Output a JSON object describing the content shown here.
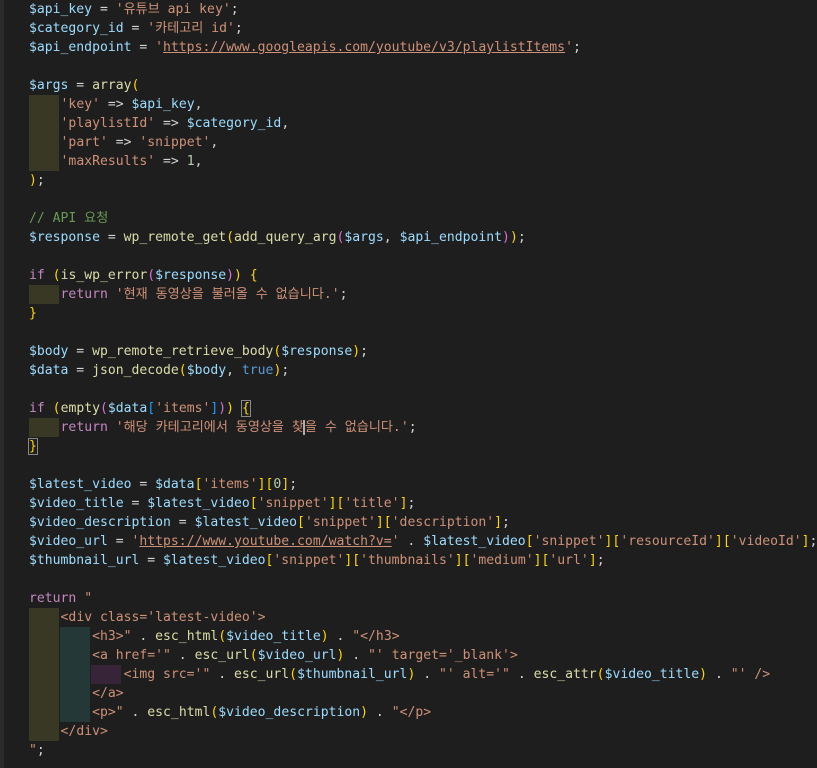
{
  "editor": {
    "language": "php",
    "theme": "dark",
    "colors": {
      "background": "#1e1e1e",
      "variable": "#9cdcfe",
      "string": "#ce9178",
      "function": "#dcdcaa",
      "keyword": "#c586c0",
      "constant": "#569cd6",
      "comment": "#6a9955",
      "number": "#b5cea8",
      "bracket_level1": "#ffd700",
      "bracket_level2": "#da70d6",
      "bracket_level3": "#179fff"
    },
    "lines": [
      {
        "indent": 0,
        "tokens": [
          [
            "var",
            "$api_key"
          ],
          [
            "op",
            " = "
          ],
          [
            "str",
            "'유튜브 api key'"
          ],
          [
            "op",
            ";"
          ]
        ]
      },
      {
        "indent": 0,
        "tokens": [
          [
            "var",
            "$category_id"
          ],
          [
            "op",
            " = "
          ],
          [
            "str",
            "'카테고리 id'"
          ],
          [
            "op",
            ";"
          ]
        ]
      },
      {
        "indent": 0,
        "tokens": [
          [
            "var",
            "$api_endpoint"
          ],
          [
            "op",
            " = "
          ],
          [
            "str",
            "'"
          ],
          [
            "str-link",
            "https://www.googleapis.com/youtube/v3/playlistItems"
          ],
          [
            "str",
            "'"
          ],
          [
            "op",
            ";"
          ]
        ]
      },
      {
        "indent": 0,
        "tokens": []
      },
      {
        "indent": 0,
        "tokens": [
          [
            "var",
            "$args"
          ],
          [
            "op",
            " = "
          ],
          [
            "fn",
            "array"
          ],
          [
            "br1",
            "("
          ]
        ]
      },
      {
        "indent": 1,
        "tokens": [
          [
            "str",
            "'key'"
          ],
          [
            "op",
            " => "
          ],
          [
            "var",
            "$api_key"
          ],
          [
            "op",
            ","
          ]
        ]
      },
      {
        "indent": 1,
        "tokens": [
          [
            "str",
            "'playlistId'"
          ],
          [
            "op",
            " => "
          ],
          [
            "var",
            "$category_id"
          ],
          [
            "op",
            ","
          ]
        ]
      },
      {
        "indent": 1,
        "tokens": [
          [
            "str",
            "'part'"
          ],
          [
            "op",
            " => "
          ],
          [
            "str",
            "'snippet'"
          ],
          [
            "op",
            ","
          ]
        ]
      },
      {
        "indent": 1,
        "tokens": [
          [
            "str",
            "'maxResults'"
          ],
          [
            "op",
            " => "
          ],
          [
            "num",
            "1"
          ],
          [
            "op",
            ","
          ]
        ]
      },
      {
        "indent": 0,
        "tokens": [
          [
            "br1",
            ")"
          ],
          [
            "op",
            ";"
          ]
        ]
      },
      {
        "indent": 0,
        "tokens": []
      },
      {
        "indent": 0,
        "tokens": [
          [
            "cmt",
            "// API 요청"
          ]
        ]
      },
      {
        "indent": 0,
        "tokens": [
          [
            "var",
            "$response"
          ],
          [
            "op",
            " = "
          ],
          [
            "fn",
            "wp_remote_get"
          ],
          [
            "br1",
            "("
          ],
          [
            "fn",
            "add_query_arg"
          ],
          [
            "br2",
            "("
          ],
          [
            "var",
            "$args"
          ],
          [
            "op",
            ", "
          ],
          [
            "var",
            "$api_endpoint"
          ],
          [
            "br2",
            ")"
          ],
          [
            "br1",
            ")"
          ],
          [
            "op",
            ";"
          ]
        ]
      },
      {
        "indent": 0,
        "tokens": []
      },
      {
        "indent": 0,
        "tokens": [
          [
            "kw",
            "if"
          ],
          [
            "op",
            " "
          ],
          [
            "br1",
            "("
          ],
          [
            "fn",
            "is_wp_error"
          ],
          [
            "br2",
            "("
          ],
          [
            "var",
            "$response"
          ],
          [
            "br2",
            ")"
          ],
          [
            "br1",
            ")"
          ],
          [
            "op",
            " "
          ],
          [
            "br1",
            "{"
          ]
        ]
      },
      {
        "indent": 1,
        "tokens": [
          [
            "kw",
            "return"
          ],
          [
            "op",
            " "
          ],
          [
            "str",
            "'현재 동영상을 불러올 수 없습니다.'"
          ],
          [
            "op",
            ";"
          ]
        ]
      },
      {
        "indent": 0,
        "tokens": [
          [
            "br1",
            "}"
          ]
        ]
      },
      {
        "indent": 0,
        "tokens": []
      },
      {
        "indent": 0,
        "tokens": [
          [
            "var",
            "$body"
          ],
          [
            "op",
            " = "
          ],
          [
            "fn",
            "wp_remote_retrieve_body"
          ],
          [
            "br1",
            "("
          ],
          [
            "var",
            "$response"
          ],
          [
            "br1",
            ")"
          ],
          [
            "op",
            ";"
          ]
        ]
      },
      {
        "indent": 0,
        "tokens": [
          [
            "var",
            "$data"
          ],
          [
            "op",
            " = "
          ],
          [
            "fn",
            "json_decode"
          ],
          [
            "br1",
            "("
          ],
          [
            "var",
            "$body"
          ],
          [
            "op",
            ", "
          ],
          [
            "const",
            "true"
          ],
          [
            "br1",
            ")"
          ],
          [
            "op",
            ";"
          ]
        ]
      },
      {
        "indent": 0,
        "tokens": []
      },
      {
        "indent": 0,
        "tokens": [
          [
            "kw",
            "if"
          ],
          [
            "op",
            " "
          ],
          [
            "br1",
            "("
          ],
          [
            "fn",
            "empty"
          ],
          [
            "br2",
            "("
          ],
          [
            "var",
            "$data"
          ],
          [
            "br3",
            "["
          ],
          [
            "str",
            "'items'"
          ],
          [
            "br3",
            "]"
          ],
          [
            "br2",
            ")"
          ],
          [
            "br1",
            ")"
          ],
          [
            "op",
            " "
          ],
          [
            "br1-match",
            "{"
          ]
        ]
      },
      {
        "indent": 1,
        "tokens": [
          [
            "kw",
            "return"
          ],
          [
            "op",
            " "
          ],
          [
            "str",
            "'해당 카테고리에서 동영상을 찾"
          ],
          [
            "cursor",
            ""
          ],
          [
            "str",
            "을 수 없습니다.'"
          ],
          [
            "op",
            ";"
          ]
        ]
      },
      {
        "indent": 0,
        "tokens": [
          [
            "br1-match",
            "}"
          ]
        ]
      },
      {
        "indent": 0,
        "tokens": []
      },
      {
        "indent": 0,
        "tokens": [
          [
            "var",
            "$latest_video"
          ],
          [
            "op",
            " = "
          ],
          [
            "var",
            "$data"
          ],
          [
            "br1",
            "["
          ],
          [
            "str",
            "'items'"
          ],
          [
            "br1",
            "]"
          ],
          [
            "br1",
            "["
          ],
          [
            "num",
            "0"
          ],
          [
            "br1",
            "]"
          ],
          [
            "op",
            ";"
          ]
        ]
      },
      {
        "indent": 0,
        "tokens": [
          [
            "var",
            "$video_title"
          ],
          [
            "op",
            " = "
          ],
          [
            "var",
            "$latest_video"
          ],
          [
            "br1",
            "["
          ],
          [
            "str",
            "'snippet'"
          ],
          [
            "br1",
            "]"
          ],
          [
            "br1",
            "["
          ],
          [
            "str",
            "'title'"
          ],
          [
            "br1",
            "]"
          ],
          [
            "op",
            ";"
          ]
        ]
      },
      {
        "indent": 0,
        "tokens": [
          [
            "var",
            "$video_description"
          ],
          [
            "op",
            " = "
          ],
          [
            "var",
            "$latest_video"
          ],
          [
            "br1",
            "["
          ],
          [
            "str",
            "'snippet'"
          ],
          [
            "br1",
            "]"
          ],
          [
            "br1",
            "["
          ],
          [
            "str",
            "'description'"
          ],
          [
            "br1",
            "]"
          ],
          [
            "op",
            ";"
          ]
        ]
      },
      {
        "indent": 0,
        "tokens": [
          [
            "var",
            "$video_url"
          ],
          [
            "op",
            " = "
          ],
          [
            "str",
            "'"
          ],
          [
            "str-link",
            "https://www.youtube.com/watch?v="
          ],
          [
            "str",
            "'"
          ],
          [
            "op",
            " . "
          ],
          [
            "var",
            "$latest_video"
          ],
          [
            "br1",
            "["
          ],
          [
            "str",
            "'snippet'"
          ],
          [
            "br1",
            "]"
          ],
          [
            "br1",
            "["
          ],
          [
            "str",
            "'resourceId'"
          ],
          [
            "br1",
            "]"
          ],
          [
            "br1",
            "["
          ],
          [
            "str",
            "'videoId'"
          ],
          [
            "br1",
            "]"
          ],
          [
            "op",
            ";"
          ]
        ]
      },
      {
        "indent": 0,
        "tokens": [
          [
            "var",
            "$thumbnail_url"
          ],
          [
            "op",
            " = "
          ],
          [
            "var",
            "$latest_video"
          ],
          [
            "br1",
            "["
          ],
          [
            "str",
            "'snippet'"
          ],
          [
            "br1",
            "]"
          ],
          [
            "br1",
            "["
          ],
          [
            "str",
            "'thumbnails'"
          ],
          [
            "br1",
            "]"
          ],
          [
            "br1",
            "["
          ],
          [
            "str",
            "'medium'"
          ],
          [
            "br1",
            "]"
          ],
          [
            "br1",
            "["
          ],
          [
            "str",
            "'url'"
          ],
          [
            "br1",
            "]"
          ],
          [
            "op",
            ";"
          ]
        ]
      },
      {
        "indent": 0,
        "tokens": []
      },
      {
        "indent": 0,
        "tokens": [
          [
            "kw",
            "return"
          ],
          [
            "op",
            " "
          ],
          [
            "str",
            "\""
          ]
        ]
      },
      {
        "indent": 1,
        "tokens": [
          [
            "str",
            "<div class='latest-video'>"
          ]
        ]
      },
      {
        "indent": 2,
        "tokens": [
          [
            "str",
            "<h3>\""
          ],
          [
            "op",
            " . "
          ],
          [
            "fn",
            "esc_html"
          ],
          [
            "br1",
            "("
          ],
          [
            "var",
            "$video_title"
          ],
          [
            "br1",
            ")"
          ],
          [
            "op",
            " . "
          ],
          [
            "str",
            "\"</h3>"
          ]
        ]
      },
      {
        "indent": 2,
        "tokens": [
          [
            "str",
            "<a href='\""
          ],
          [
            "op",
            " . "
          ],
          [
            "fn",
            "esc_url"
          ],
          [
            "br1",
            "("
          ],
          [
            "var",
            "$video_url"
          ],
          [
            "br1",
            ")"
          ],
          [
            "op",
            " . "
          ],
          [
            "str",
            "\"' target='_blank'>"
          ]
        ]
      },
      {
        "indent": 3,
        "tokens": [
          [
            "str",
            "<img src='\""
          ],
          [
            "op",
            " . "
          ],
          [
            "fn",
            "esc_url"
          ],
          [
            "br1",
            "("
          ],
          [
            "var",
            "$thumbnail_url"
          ],
          [
            "br1",
            ")"
          ],
          [
            "op",
            " . "
          ],
          [
            "str",
            "\"' alt='\""
          ],
          [
            "op",
            " . "
          ],
          [
            "fn",
            "esc_attr"
          ],
          [
            "br1",
            "("
          ],
          [
            "var",
            "$video_title"
          ],
          [
            "br1",
            ")"
          ],
          [
            "op",
            " . "
          ],
          [
            "str",
            "\"' />"
          ]
        ]
      },
      {
        "indent": 2,
        "tokens": [
          [
            "str",
            "</a>"
          ]
        ]
      },
      {
        "indent": 2,
        "tokens": [
          [
            "str",
            "<p>\""
          ],
          [
            "op",
            " . "
          ],
          [
            "fn",
            "esc_html"
          ],
          [
            "br1",
            "("
          ],
          [
            "var",
            "$video_description"
          ],
          [
            "br1",
            ")"
          ],
          [
            "op",
            " . "
          ],
          [
            "str",
            "\"</p>"
          ]
        ]
      },
      {
        "indent": 1,
        "tokens": [
          [
            "str",
            "</div>"
          ]
        ]
      },
      {
        "indent": 0,
        "tokens": [
          [
            "str",
            "\""
          ],
          [
            "op",
            ";"
          ]
        ]
      }
    ]
  }
}
